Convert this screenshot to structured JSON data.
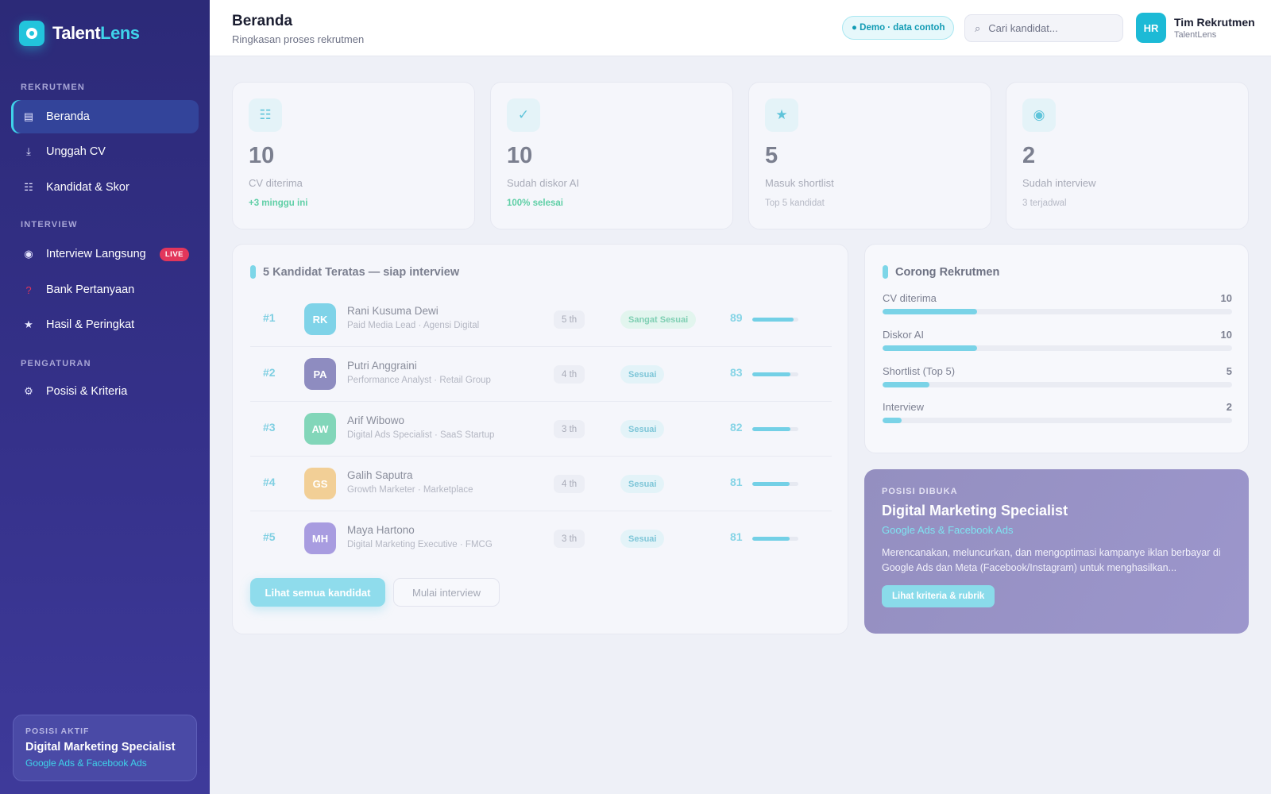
{
  "brand": {
    "name_a": "Talent",
    "name_b": "Lens"
  },
  "sidebar": {
    "sections": {
      "rekrutmen": "REKRUTMEN",
      "interview": "INTERVIEW",
      "pengaturan": "PENGATURAN"
    },
    "items": [
      {
        "label": "Beranda",
        "icon": "home-icon"
      },
      {
        "label": "Unggah CV",
        "icon": "upload-icon"
      },
      {
        "label": "Kandidat & Skor",
        "icon": "list-icon"
      },
      {
        "label": "Interview Langsung",
        "icon": "record-icon",
        "badge": "LIVE"
      },
      {
        "label": "Bank Pertanyaan",
        "icon": "question-icon"
      },
      {
        "label": "Hasil & Peringkat",
        "icon": "star-icon"
      },
      {
        "label": "Posisi & Kriteria",
        "icon": "gear-icon"
      }
    ],
    "active_position": {
      "kicker": "POSISI AKTIF",
      "title": "Digital Marketing Specialist",
      "subtitle": "Google Ads & Facebook Ads"
    }
  },
  "header": {
    "title": "Beranda",
    "subtitle": "Ringkasan proses rekrutmen",
    "demo_badge": "● Demo · data contoh",
    "search_placeholder": "Cari kandidat...",
    "user_initials": "HR",
    "user_name": "Tim Rekrutmen",
    "user_org": "TalentLens"
  },
  "stats": [
    {
      "value": "10",
      "label": "CV diterima",
      "note": "+3 minggu ini",
      "icon": "document-icon"
    },
    {
      "value": "10",
      "label": "Sudah diskor AI",
      "note": "100% selesai",
      "icon": "check-icon"
    },
    {
      "value": "5",
      "label": "Masuk shortlist",
      "note": "Top 5 kandidat",
      "icon": "star-icon"
    },
    {
      "value": "2",
      "label": "Sudah interview",
      "note": "3 terjadwal",
      "icon": "target-icon"
    }
  ],
  "top_candidates": {
    "title": "5 Kandidat Teratas — siap interview",
    "rows": [
      {
        "rank": "#1",
        "initials": "RK",
        "name": "Rani Kusuma Dewi",
        "role": "Paid Media Lead · Agensi Digital",
        "exp": "5 th",
        "fit": "Sangat Sesuai",
        "score": "89",
        "score_pct": 0.89,
        "color": "#7fd3e8"
      },
      {
        "rank": "#2",
        "initials": "PA",
        "name": "Putri Anggraini",
        "role": "Performance Analyst · Retail Group",
        "exp": "4 th",
        "fit": "Sesuai",
        "score": "83",
        "score_pct": 0.83,
        "color": "#8e8cc0"
      },
      {
        "rank": "#3",
        "initials": "AW",
        "name": "Arif Wibowo",
        "role": "Digital Ads Specialist · SaaS Startup",
        "exp": "3 th",
        "fit": "Sesuai",
        "score": "82",
        "score_pct": 0.82,
        "color": "#82d6b9"
      },
      {
        "rank": "#4",
        "initials": "GS",
        "name": "Galih Saputra",
        "role": "Growth Marketer · Marketplace",
        "exp": "4 th",
        "fit": "Sesuai",
        "score": "81",
        "score_pct": 0.81,
        "color": "#f2cf96"
      },
      {
        "rank": "#5",
        "initials": "MH",
        "name": "Maya Hartono",
        "role": "Digital Marketing Executive · FMCG",
        "exp": "3 th",
        "fit": "Sesuai",
        "score": "81",
        "score_pct": 0.81,
        "color": "#a89ce0"
      }
    ],
    "btn_all": "Lihat semua kandidat",
    "btn_interview": "Mulai interview"
  },
  "funnel": {
    "title": "Corong Rekrutmen",
    "rows": [
      {
        "label": "CV diterima",
        "value": "10",
        "fraction": 0.27
      },
      {
        "label": "Diskor AI",
        "value": "10",
        "fraction": 0.27
      },
      {
        "label": "Shortlist (Top 5)",
        "value": "5",
        "fraction": 0.135
      },
      {
        "label": "Interview",
        "value": "2",
        "fraction": 0.055
      }
    ]
  },
  "open_position": {
    "kicker": "POSISI DIBUKA",
    "title": "Digital Marketing Specialist",
    "subtitle": "Google Ads & Facebook Ads",
    "description": "Merencanakan, meluncurkan, dan mengoptimasi kampanye iklan berbayar di Google Ads dan Meta (Facebook/Instagram) untuk menghasilkan...",
    "button": "Lihat kriteria & rubrik"
  }
}
